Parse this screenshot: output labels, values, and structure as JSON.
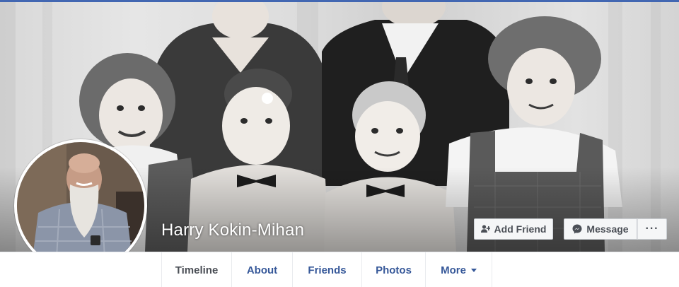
{
  "profile": {
    "name": "Harry Kokin-Mihan"
  },
  "actions": {
    "add_friend_label": "Add Friend",
    "message_label": "Message",
    "more_label": "···"
  },
  "nav": {
    "tabs": [
      {
        "label": "Timeline",
        "active": true
      },
      {
        "label": "About"
      },
      {
        "label": "Friends"
      },
      {
        "label": "Photos"
      },
      {
        "label": "More"
      }
    ]
  },
  "colors": {
    "accent": "#4267b2",
    "link": "#365899",
    "button_bg": "#f5f6f7",
    "button_text": "#4b4f56"
  },
  "icons": {
    "add_friend": "person-plus-icon",
    "message": "messenger-icon",
    "more": "ellipsis-icon",
    "more_tab": "caret-down-icon"
  }
}
